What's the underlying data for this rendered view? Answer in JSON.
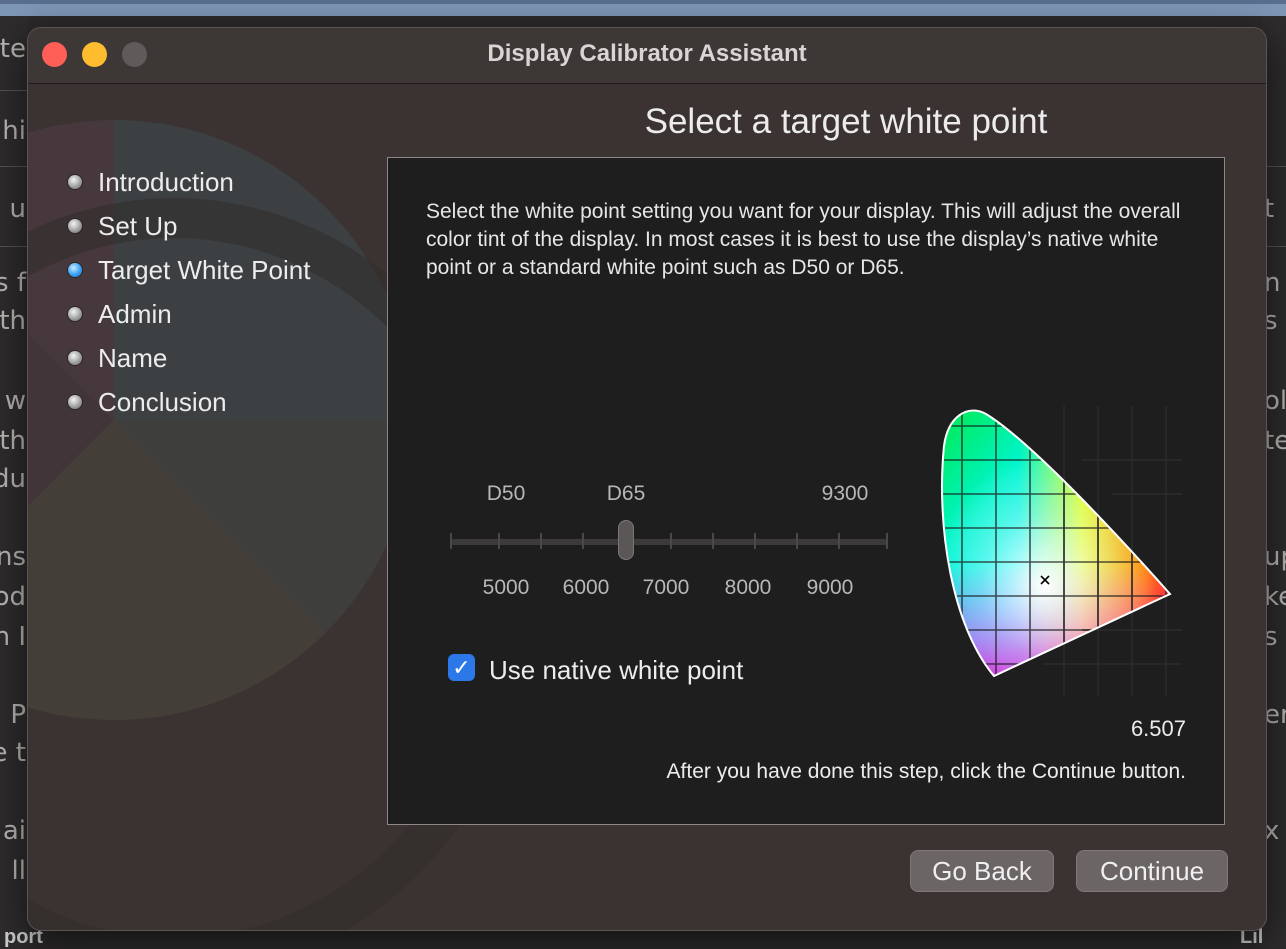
{
  "window": {
    "title": "Display Calibrator Assistant"
  },
  "background": {
    "left_fragments": [
      "ute",
      "hi",
      "u",
      "s f",
      "th",
      ", w",
      "th",
      "du",
      "ns",
      "od",
      "n I",
      "n P",
      "e t",
      "ai",
      "ll"
    ],
    "right_fragments": [
      "t",
      "n",
      "s r",
      "ol",
      "te",
      "up",
      "ke",
      "s",
      "er",
      "x"
    ],
    "bottom_left": "port",
    "bottom_right": "Lil"
  },
  "steps": [
    {
      "label": "Introduction",
      "state": "done"
    },
    {
      "label": "Set Up",
      "state": "done"
    },
    {
      "label": "Target White Point",
      "state": "active"
    },
    {
      "label": "Admin",
      "state": "pending"
    },
    {
      "label": "Name",
      "state": "pending"
    },
    {
      "label": "Conclusion",
      "state": "pending"
    }
  ],
  "heading": "Select a target white point",
  "description": "Select the white point setting you want for your display.  This will adjust the overall color tint of the display.  In most cases it is best to use the display’s native white point or a standard white point such as D50 or D65.",
  "slider": {
    "top_labels": [
      "D50",
      "D65",
      "9300"
    ],
    "bottom_labels": [
      "5000",
      "6000",
      "7000",
      "8000",
      "9000"
    ],
    "value_kelvin": 6500
  },
  "native_checkbox": {
    "label": "Use native white point",
    "checked": true
  },
  "chromaticity_value": "6.507",
  "hint": "After you have done this step, click the Continue button.",
  "buttons": {
    "back": "Go Back",
    "continue": "Continue"
  },
  "colors": {
    "accent": "#2c78e8",
    "active_step": "#3aa0f4",
    "close": "#ff5f57",
    "minimize": "#febc2e"
  }
}
